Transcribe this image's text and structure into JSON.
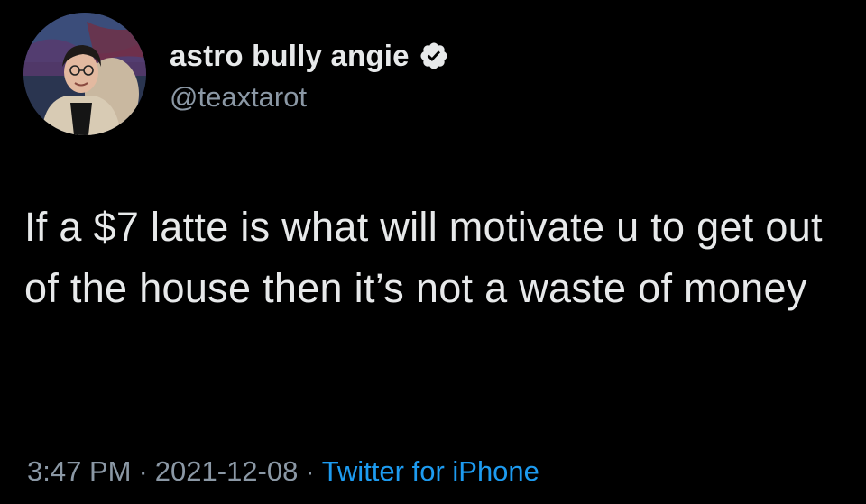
{
  "tweet": {
    "author": {
      "display_name": "astro bully angie",
      "handle": "@teaxtarot",
      "verified": true,
      "avatar_icon": "profile-photo"
    },
    "text": "If a $7 latte is what will motivate u to get out of the house then it’s not a waste of money",
    "meta": {
      "time": "3:47 PM",
      "separator": "·",
      "date": "2021-12-08",
      "source": "Twitter for iPhone"
    }
  },
  "colors": {
    "background": "#000000",
    "text_primary": "#e7e9ea",
    "text_secondary": "#8b98a5",
    "link": "#1d9bf0",
    "verified_badge": "#e7e9ea"
  }
}
